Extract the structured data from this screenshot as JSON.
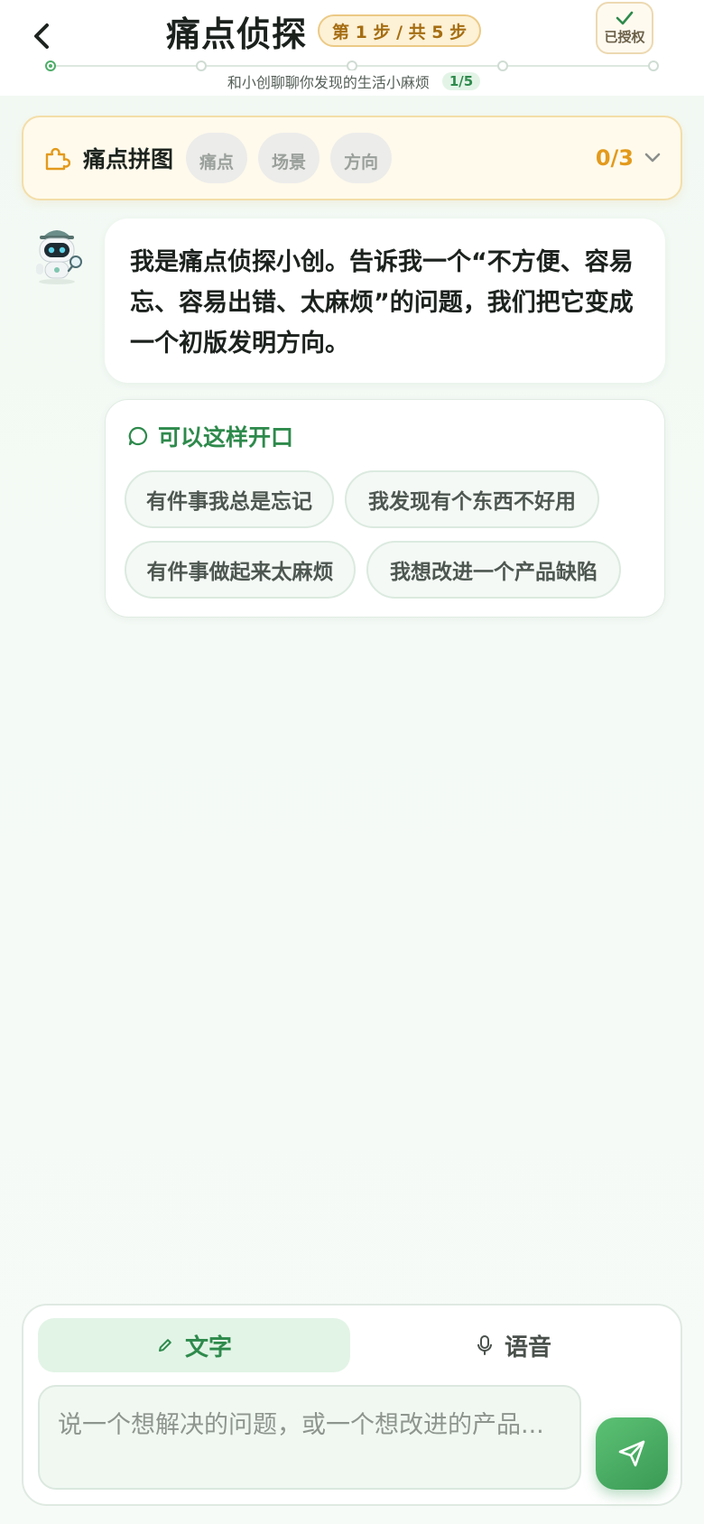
{
  "header": {
    "back_icon": "chevron-left-icon",
    "title": "痛点侦探",
    "step_badge": "第 1 步 / 共 5 步",
    "auth_label": "已授权",
    "auth_icon": "check-icon",
    "subtitle": "和小创聊聊你发现的生活小麻烦",
    "progress_text": "1/5",
    "progress": {
      "current": 1,
      "total": 5
    },
    "accent_color": "#2e8a4c"
  },
  "puzzle": {
    "icon": "puzzle-icon",
    "title": "痛点拼图",
    "chips": [
      "痛点",
      "场景",
      "方向"
    ],
    "count": "0/3",
    "expand_icon": "chevron-down-icon",
    "accent_color": "#e39a1c"
  },
  "chat": {
    "assistant_avatar": "robot-detective-avatar",
    "message": "我是痛点侦探小创。告诉我一个“不方便、容易忘、容易出错、太麻烦”的问题，我们把它变成一个初版发明方向。",
    "starters": {
      "icon": "chat-bubble-icon",
      "title": "可以这样开口",
      "options": [
        "有件事我总是忘记",
        "我发现有个东西不好用",
        "有件事做起来太麻烦",
        "我想改进一个产品缺陷"
      ]
    }
  },
  "composer": {
    "modes": [
      {
        "label": "文字",
        "icon": "pencil-icon",
        "active": true
      },
      {
        "label": "语音",
        "icon": "microphone-icon",
        "active": false
      }
    ],
    "input_placeholder": "说一个想解决的问题，或一个想改进的产品...",
    "input_value": "",
    "send_icon": "send-icon"
  }
}
